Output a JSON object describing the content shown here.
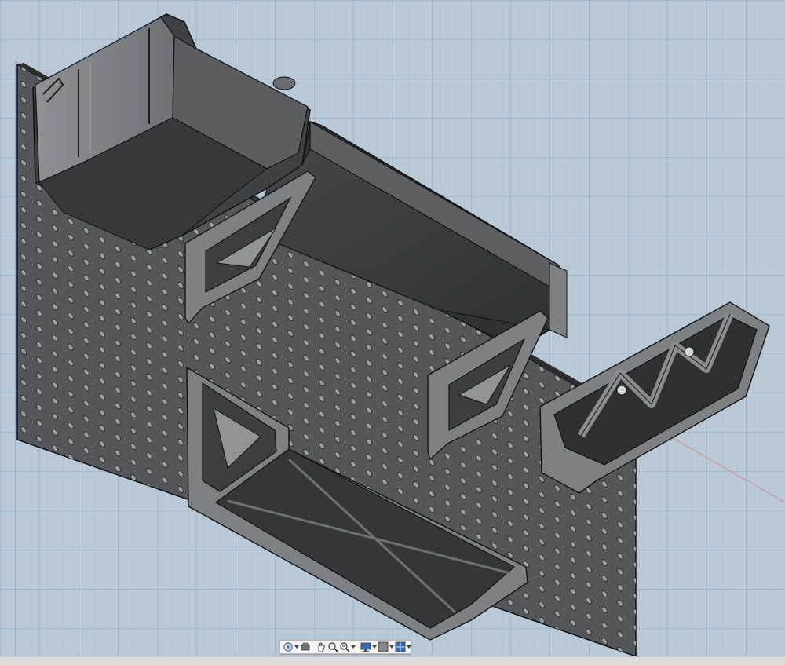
{
  "viewport": {
    "background_color": "#b9c9d6",
    "grid_minor_color": "#a9bccb",
    "grid_major_color": "#93a9ba",
    "axis_red_color": "#d98a8a",
    "axis_blue_color": "#7f8fd6",
    "model_dark_color": "#3a3c40",
    "model_mid_color": "#56595e",
    "model_light_color": "#8a8e93",
    "edge_color": "#111214"
  },
  "nav_toolbar": {
    "buttons": [
      {
        "name": "orbit-icon",
        "has_dropdown": true
      },
      {
        "name": "look-at-icon",
        "has_dropdown": false
      },
      {
        "name": "pan-icon",
        "has_dropdown": false
      },
      {
        "name": "zoom-icon",
        "has_dropdown": false
      },
      {
        "name": "fit-zoom-icon",
        "has_dropdown": true
      },
      {
        "name": "display-settings-icon",
        "has_dropdown": true
      },
      {
        "name": "grid-snap-icon",
        "has_dropdown": true
      },
      {
        "name": "viewports-icon",
        "has_dropdown": true
      }
    ]
  }
}
